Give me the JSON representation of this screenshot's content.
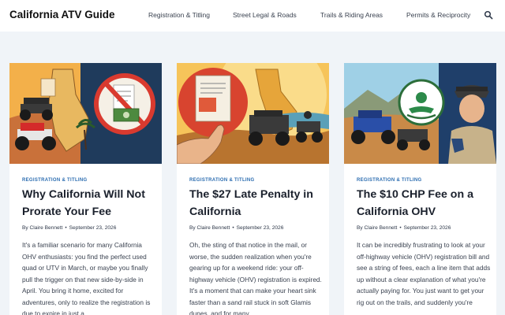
{
  "site": {
    "title": "California ATV Guide"
  },
  "nav": {
    "items": [
      "Registration & Titling",
      "Street Legal & Roads",
      "Trails & Riding Areas",
      "Permits & Reciprocity"
    ],
    "search_icon": "search-icon"
  },
  "posts": [
    {
      "category": "REGISTRATION & TITLING",
      "title": "Why California Will Not Prorate Your Fee",
      "author": "By Claire Bennett",
      "separator": "•",
      "date": "September 23, 2026",
      "excerpt": "It's a familiar scenario for many California OHV enthusiasts: you find the perfect used quad or UTV in March, or maybe you finally pull the trigger on that new side-by-side in April. You bring it home, excited for adventures, only to realize the registration is due to expire in just a"
    },
    {
      "category": "REGISTRATION & TITLING",
      "title": "The $27 Late Penalty in California",
      "author": "By Claire Bennett",
      "separator": "•",
      "date": "September 23, 2026",
      "excerpt": "Oh, the sting of that notice in the mail, or worse, the sudden realization when you're gearing up for a weekend ride: your off-highway vehicle (OHV) registration is expired. It's a moment that can make your heart sink faster than a sand rail stuck in soft Glamis dunes, and for many"
    },
    {
      "category": "REGISTRATION & TITLING",
      "title": "The $10 CHP Fee on a California OHV",
      "author": "By Claire Bennett",
      "separator": "•",
      "date": "September 23, 2026",
      "excerpt": "It can be incredibly frustrating to look at your off-highway vehicle (OHV) registration bill and see a string of fees, each a line item that adds up without a clear explanation of what you're actually paying for. You just want to get your rig out on the trails, and suddenly you're"
    }
  ],
  "colors": {
    "accent": "#2b6cb0",
    "background": "#f0f4f8",
    "header_bg": "#ffffff"
  }
}
